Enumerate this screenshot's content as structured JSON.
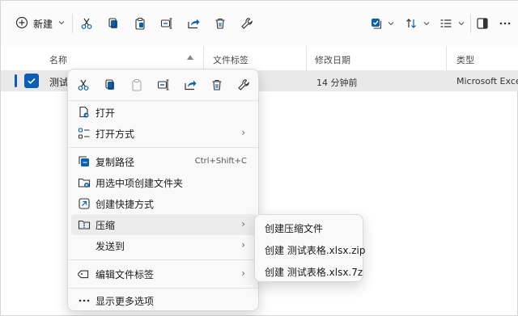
{
  "toolbar": {
    "new_label": "新建",
    "icons": [
      "plus-circle-icon",
      "cut-icon",
      "copy-icon",
      "paste-icon",
      "rename-icon",
      "share-icon",
      "delete-icon",
      "properties-icon",
      "select-icon",
      "sort-icon",
      "view-icon",
      "details-pane-icon",
      "more-icon"
    ]
  },
  "columns": {
    "name": "名称",
    "tags": "文件标签",
    "modified": "修改日期",
    "type": "类型"
  },
  "file": {
    "name": "测试",
    "modified": "14 分钟前",
    "type": "Microsoft Excel"
  },
  "context_menu": {
    "items": [
      {
        "label": "打开",
        "icon": "open-icon"
      },
      {
        "label": "打开方式",
        "icon": "open-with-icon",
        "has_submenu": true
      },
      {
        "label": "复制路径",
        "icon": "copy-path-icon",
        "shortcut": "Ctrl+Shift+C"
      },
      {
        "label": "用选中项创建文件夹",
        "icon": "new-folder-icon"
      },
      {
        "label": "创建快捷方式",
        "icon": "shortcut-icon"
      },
      {
        "label": "压缩",
        "icon": "compress-icon",
        "has_submenu": true
      },
      {
        "label": "发送到",
        "has_submenu": true
      },
      {
        "label": "编辑文件标签",
        "icon": "tag-icon",
        "has_submenu": true
      },
      {
        "label": "显示更多选项",
        "icon": "more-options-icon"
      }
    ]
  },
  "submenu": {
    "items": [
      "创建压缩文件",
      "创建 测试表格.xlsx.zip",
      "创建 测试表格.xlsx.7z"
    ]
  },
  "colors": {
    "accent": "#0a5fb4",
    "selection": "#e9e9e9",
    "menu_bg": "#f9f9f9"
  }
}
